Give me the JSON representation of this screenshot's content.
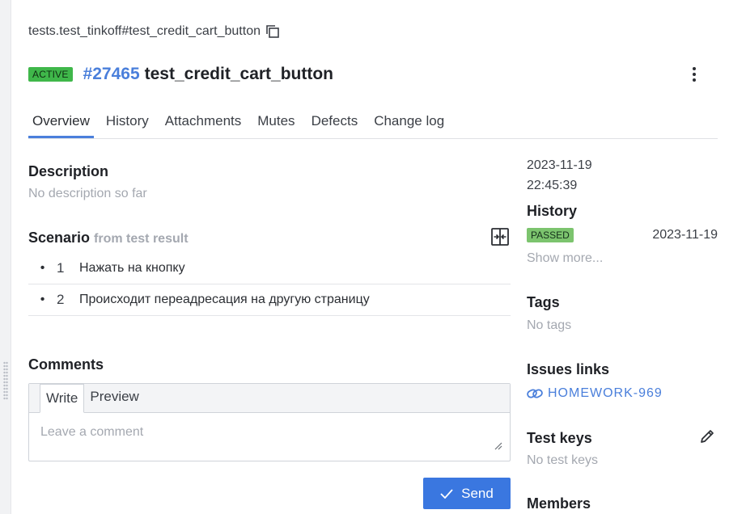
{
  "breadcrumb": {
    "path": "tests.test_tinkoff#test_credit_cart_button"
  },
  "header": {
    "status": "ACTIVE",
    "id": "#27465",
    "name": "test_credit_cart_button"
  },
  "tabs": [
    {
      "label": "Overview",
      "active": true
    },
    {
      "label": "History",
      "active": false
    },
    {
      "label": "Attachments",
      "active": false
    },
    {
      "label": "Mutes",
      "active": false
    },
    {
      "label": "Defects",
      "active": false
    },
    {
      "label": "Change log",
      "active": false
    }
  ],
  "description": {
    "title": "Description",
    "empty_text": "No description so far"
  },
  "scenario": {
    "title": "Scenario",
    "source": "from test result",
    "steps": [
      {
        "bullet": "•",
        "number": "1",
        "text": "Нажать на кнопку"
      },
      {
        "bullet": "•",
        "number": "2",
        "text": "Происходит переадресация на другую страницу"
      }
    ]
  },
  "comments": {
    "title": "Comments",
    "tab_write": "Write",
    "tab_preview": "Preview",
    "placeholder": "Leave a comment",
    "value": "",
    "send_label": "Send"
  },
  "sidebar": {
    "date": "2023-11-19",
    "time": "22:45:39",
    "history_title": "History",
    "history_status": "PASSED",
    "history_date": "2023-11-19",
    "show_more": "Show more...",
    "tags_title": "Tags",
    "tags_empty": "No tags",
    "issues_title": "Issues links",
    "issue_key": "HOMEWORK-969",
    "test_keys_title": "Test keys",
    "test_keys_empty": "No test keys",
    "members_title": "Members"
  },
  "colors": {
    "accent": "#4a7fdb",
    "button": "#3a77e0",
    "active_badge": "#3fb74a",
    "passed_badge": "#7cc46e",
    "muted_text": "#a4a8b0"
  },
  "icons": {
    "copy": "copy-icon",
    "more": "more-vertical-icon",
    "scenario_toggle": "split-view-icon",
    "resize": "resize-grip-icon",
    "send": "check-icon",
    "link": "link-icon",
    "edit": "pencil-icon"
  }
}
